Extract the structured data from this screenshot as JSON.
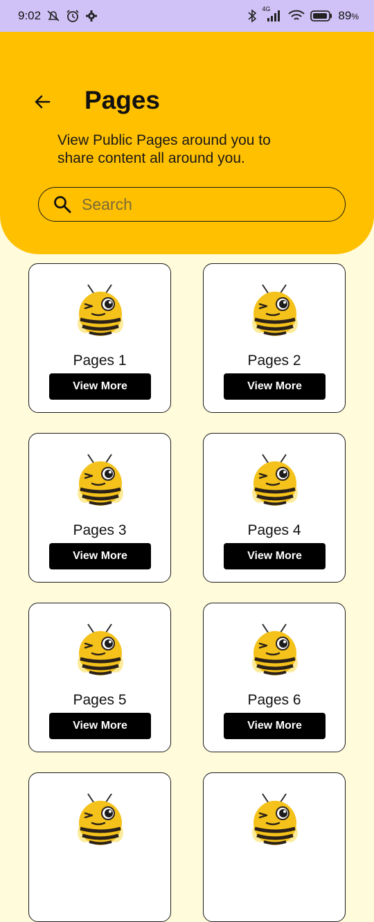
{
  "status_bar": {
    "time": "9:02",
    "battery": "89",
    "battery_unit": "%",
    "network": "4G",
    "icons": [
      "muted-notifications-icon",
      "alarm-icon",
      "settings-icon",
      "bluetooth-icon",
      "signal-icon",
      "wifi-icon",
      "battery-icon"
    ]
  },
  "header": {
    "back_icon": "arrow-left-icon",
    "title": "Pages",
    "subtitle": "View Public Pages around you to share content all around you.",
    "background_color": "#ffc000"
  },
  "search": {
    "icon": "search-icon",
    "placeholder": "Search",
    "value": ""
  },
  "pages": [
    {
      "label": "Pages 1",
      "button": "View More"
    },
    {
      "label": "Pages 2",
      "button": "View More"
    },
    {
      "label": "Pages 3",
      "button": "View More"
    },
    {
      "label": "Pages 4",
      "button": "View More"
    },
    {
      "label": "Pages 5",
      "button": "View More"
    },
    {
      "label": "Pages 6",
      "button": "View More"
    },
    {
      "label": "",
      "button": ""
    },
    {
      "label": "",
      "button": ""
    }
  ],
  "colors": {
    "page_background": "#fffbdb",
    "status_bar": "#d0c2f6",
    "button": "#000000"
  }
}
